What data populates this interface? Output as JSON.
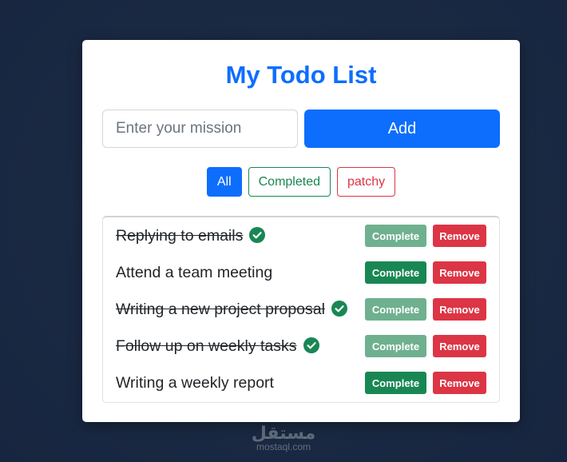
{
  "app": {
    "title": "My Todo List"
  },
  "input": {
    "placeholder": "Enter your mission",
    "value": ""
  },
  "add_button": {
    "label": "Add"
  },
  "filters": [
    {
      "label": "All",
      "active": true
    },
    {
      "label": "Completed",
      "active": false
    },
    {
      "label": "patchy",
      "active": false
    }
  ],
  "todos": [
    {
      "text": "Replying to emails",
      "completed": true,
      "complete_label": "Complete",
      "remove_label": "Remove"
    },
    {
      "text": "Attend a team meeting",
      "completed": false,
      "complete_label": "Complete",
      "remove_label": "Remove"
    },
    {
      "text": "Writing a new project proposal",
      "completed": true,
      "complete_label": "Complete",
      "remove_label": "Remove"
    },
    {
      "text": "Follow up on weekly tasks",
      "completed": true,
      "complete_label": "Complete",
      "remove_label": "Remove"
    },
    {
      "text": "Writing a weekly report",
      "completed": false,
      "complete_label": "Complete",
      "remove_label": "Remove"
    }
  ],
  "colors": {
    "primary": "#0d6efd",
    "success": "#198754",
    "success_faded": "#6fb08f",
    "danger": "#dc3545",
    "page_background": "#1b2a44"
  },
  "icons": {
    "completed_marker": "check-circle-icon"
  },
  "watermark": {
    "logo": "مستقل",
    "url": "mostaql.com"
  }
}
